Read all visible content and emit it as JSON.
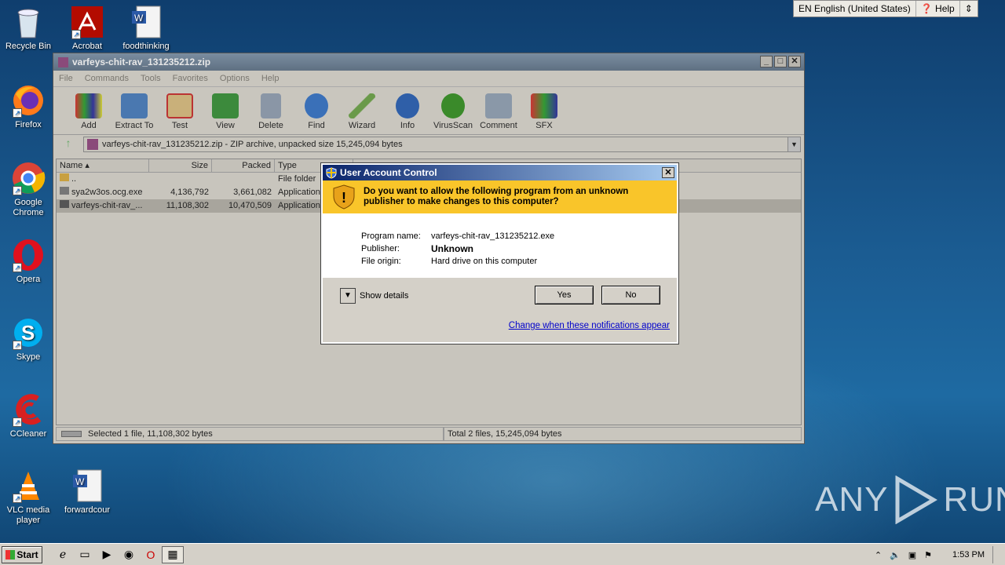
{
  "desktop": {
    "icons": [
      {
        "label": "Recycle Bin"
      },
      {
        "label": "Acrobat"
      },
      {
        "label": "foodthinking"
      },
      {
        "label": "Firefox"
      },
      {
        "label": "Google Chrome"
      },
      {
        "label": "Opera"
      },
      {
        "label": "Skype"
      },
      {
        "label": "CCleaner"
      },
      {
        "label": "VLC media player"
      },
      {
        "label": "forwardcour"
      }
    ]
  },
  "langbar": {
    "language": "EN English (United States)",
    "help": "Help"
  },
  "watermark": {
    "text_left": "ANY",
    "text_right": "RUN"
  },
  "winrar": {
    "title": "varfeys-chit-rav_131235212.zip",
    "menu": [
      "File",
      "Commands",
      "Tools",
      "Favorites",
      "Options",
      "Help"
    ],
    "toolbar": [
      "Add",
      "Extract To",
      "Test",
      "View",
      "Delete",
      "Find",
      "Wizard",
      "Info",
      "VirusScan",
      "Comment",
      "SFX"
    ],
    "address": "varfeys-chit-rav_131235212.zip - ZIP archive, unpacked size 15,245,094 bytes",
    "columns": [
      "Name",
      "Size",
      "Packed",
      "Type"
    ],
    "rows": [
      {
        "name": "..",
        "size": "",
        "packed": "",
        "type": "File folder"
      },
      {
        "name": "sya2w3os.ocg.exe",
        "size": "4,136,792",
        "packed": "3,661,082",
        "type": "Application"
      },
      {
        "name": "varfeys-chit-rav_...",
        "size": "11,108,302",
        "packed": "10,470,509",
        "type": "Application"
      }
    ],
    "status_left": "Selected 1 file, 11,108,302 bytes",
    "status_right": "Total 2 files, 15,245,094 bytes"
  },
  "uac": {
    "title": "User Account Control",
    "question": "Do you want to allow the following program from an unknown publisher to make changes to this computer?",
    "program_name_label": "Program name:",
    "program_name": "varfeys-chit-rav_131235212.exe",
    "publisher_label": "Publisher:",
    "publisher": "Unknown",
    "origin_label": "File origin:",
    "origin": "Hard drive on this computer",
    "show_details": "Show details",
    "yes": "Yes",
    "no": "No",
    "link": "Change when these notifications appear"
  },
  "taskbar": {
    "start": "Start",
    "time": "1:53 PM"
  },
  "colors": {
    "uac_banner": "#f9c52a",
    "uac_title": "#0a246a",
    "desktop": "#1b5c92"
  }
}
